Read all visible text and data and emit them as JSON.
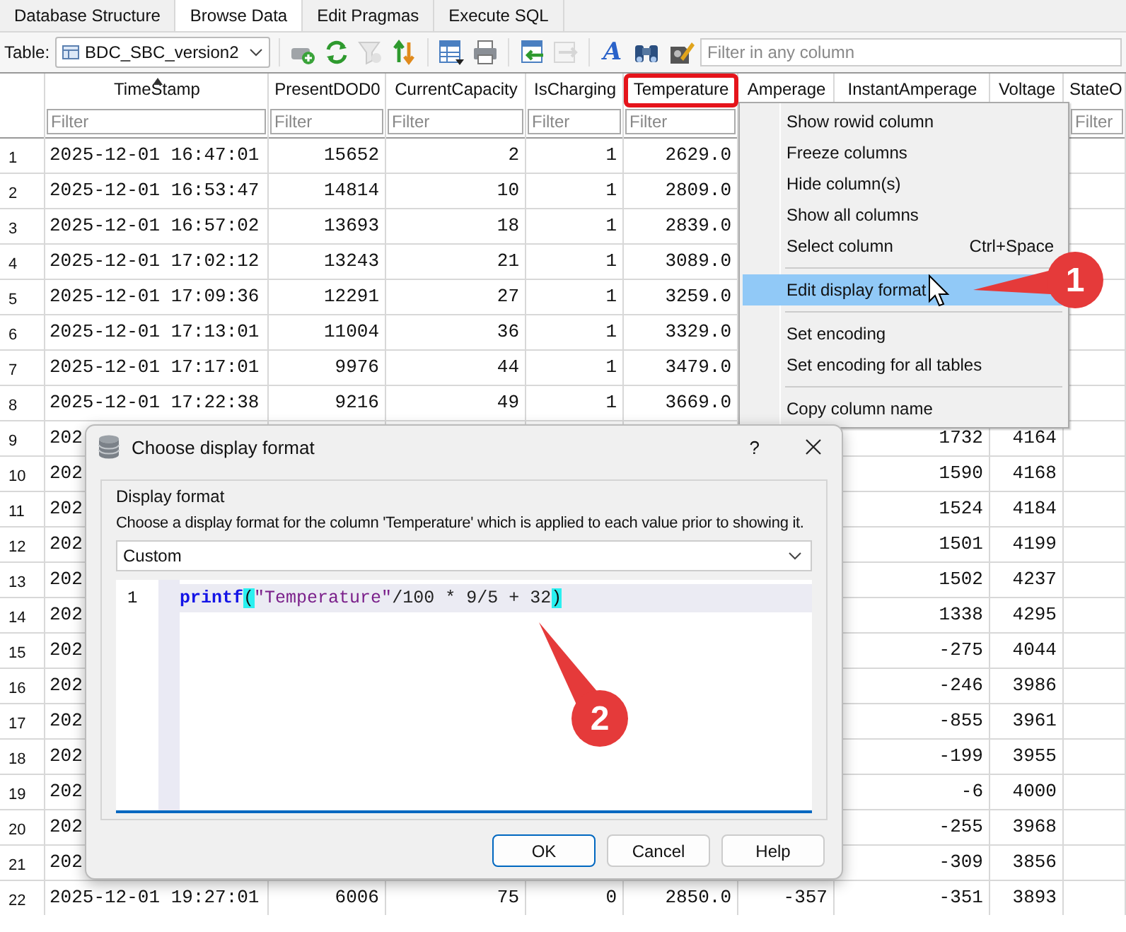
{
  "tabs": [
    {
      "label": "Database Structure",
      "selected": false
    },
    {
      "label": "Browse Data",
      "selected": true
    },
    {
      "label": "Edit Pragmas",
      "selected": false
    },
    {
      "label": "Execute SQL",
      "selected": false
    }
  ],
  "toolbar": {
    "table_label": "Table:",
    "table_name": "BDC_SBC_version2",
    "filter_placeholder": "Filter in any column",
    "tool_groups": [
      [
        {
          "kind": "add-row",
          "disabled": false
        },
        {
          "kind": "refresh",
          "disabled": false
        },
        {
          "kind": "funnel",
          "disabled": true
        },
        {
          "kind": "sort",
          "disabled": false
        }
      ],
      [
        {
          "kind": "table",
          "disabled": false
        },
        {
          "kind": "printer",
          "disabled": false
        }
      ],
      [
        {
          "kind": "import",
          "disabled": false
        },
        {
          "kind": "export",
          "disabled": true
        }
      ],
      [
        {
          "kind": "font",
          "label": "A",
          "disabled": false
        },
        {
          "kind": "binoculars",
          "disabled": false
        },
        {
          "kind": "pencil",
          "disabled": false
        }
      ]
    ]
  },
  "table": {
    "columns": [
      {
        "label": "TimeStamp",
        "sorted": true,
        "highlighted": false,
        "placeholder": "Filter"
      },
      {
        "label": "PresentDOD0",
        "sorted": false,
        "highlighted": false,
        "placeholder": "Filter"
      },
      {
        "label": "CurrentCapacity",
        "sorted": false,
        "highlighted": false,
        "placeholder": "Filter"
      },
      {
        "label": "IsCharging",
        "sorted": false,
        "highlighted": false,
        "placeholder": "Filter"
      },
      {
        "label": "Temperature",
        "sorted": false,
        "highlighted": true,
        "placeholder": "Filter"
      },
      {
        "label": "Amperage",
        "sorted": false,
        "highlighted": false
      },
      {
        "label": "InstantAmperage",
        "sorted": false,
        "highlighted": false
      },
      {
        "label": "Voltage",
        "sorted": false,
        "highlighted": false
      },
      {
        "label": "StateO",
        "sorted": false,
        "highlighted": false,
        "placeholder": "Filter"
      }
    ],
    "rows": [
      {
        "number": "1",
        "timestamp": "2025-12-01 16:47:01",
        "present_dod0": "15652",
        "current_capacity": "2",
        "is_charging": "1",
        "temperature": "2629.0"
      },
      {
        "number": "2",
        "timestamp": "2025-12-01 16:53:47",
        "present_dod0": "14814",
        "current_capacity": "10",
        "is_charging": "1",
        "temperature": "2809.0"
      },
      {
        "number": "3",
        "timestamp": "2025-12-01 16:57:02",
        "present_dod0": "13693",
        "current_capacity": "18",
        "is_charging": "1",
        "temperature": "2839.0"
      },
      {
        "number": "4",
        "timestamp": "2025-12-01 17:02:12",
        "present_dod0": "13243",
        "current_capacity": "21",
        "is_charging": "1",
        "temperature": "3089.0"
      },
      {
        "number": "5",
        "timestamp": "2025-12-01 17:09:36",
        "present_dod0": "12291",
        "current_capacity": "27",
        "is_charging": "1",
        "temperature": "3259.0"
      },
      {
        "number": "6",
        "timestamp": "2025-12-01 17:13:01",
        "present_dod0": "11004",
        "current_capacity": "36",
        "is_charging": "1",
        "temperature": "3329.0"
      },
      {
        "number": "7",
        "timestamp": "2025-12-01 17:17:01",
        "present_dod0": "9976",
        "current_capacity": "44",
        "is_charging": "1",
        "temperature": "3479.0"
      },
      {
        "number": "8",
        "timestamp": "2025-12-01 17:22:38",
        "present_dod0": "9216",
        "current_capacity": "49",
        "is_charging": "1",
        "temperature": "3669.0"
      },
      {
        "number": "9",
        "timestamp": "202",
        "instant_amperage": "1732",
        "voltage": "4164"
      },
      {
        "number": "10",
        "timestamp": "202",
        "instant_amperage": "1590",
        "voltage": "4168"
      },
      {
        "number": "11",
        "timestamp": "202",
        "instant_amperage": "1524",
        "voltage": "4184"
      },
      {
        "number": "12",
        "timestamp": "202",
        "instant_amperage": "1501",
        "voltage": "4199"
      },
      {
        "number": "13",
        "timestamp": "202",
        "instant_amperage": "1502",
        "voltage": "4237"
      },
      {
        "number": "14",
        "timestamp": "202",
        "instant_amperage": "1338",
        "voltage": "4295"
      },
      {
        "number": "15",
        "timestamp": "202",
        "instant_amperage": "-275",
        "voltage": "4044"
      },
      {
        "number": "16",
        "timestamp": "202",
        "instant_amperage": "-246",
        "voltage": "3986"
      },
      {
        "number": "17",
        "timestamp": "202",
        "instant_amperage": "-855",
        "voltage": "3961"
      },
      {
        "number": "18",
        "timestamp": "202",
        "instant_amperage": "-199",
        "voltage": "3955"
      },
      {
        "number": "19",
        "timestamp": "202",
        "instant_amperage": "-6",
        "voltage": "4000"
      },
      {
        "number": "20",
        "timestamp": "202",
        "instant_amperage": "-255",
        "voltage": "3968"
      },
      {
        "number": "21",
        "timestamp": "202",
        "instant_amperage": "-309",
        "voltage": "3856"
      },
      {
        "number": "22",
        "timestamp": "2025-12-01 19:27:01",
        "present_dod0": "6006",
        "current_capacity": "75",
        "is_charging": "0",
        "temperature": "2850.0",
        "amperage": "-357",
        "instant_amperage": "-351",
        "voltage": "3893"
      }
    ]
  },
  "context_menu": {
    "groups": [
      [
        {
          "label": "Show rowid column",
          "selected": false
        },
        {
          "label": "Freeze columns",
          "selected": false
        },
        {
          "label": "Hide column(s)",
          "selected": false
        },
        {
          "label": "Show all columns",
          "selected": false
        },
        {
          "label": "Select column",
          "shortcut": "Ctrl+Space",
          "selected": false
        }
      ],
      [
        {
          "label": "Edit display format",
          "selected": true
        }
      ],
      [
        {
          "label": "Set encoding",
          "selected": false
        },
        {
          "label": "Set encoding for all tables",
          "selected": false
        }
      ],
      [
        {
          "label": "Copy column name",
          "selected": false
        }
      ]
    ]
  },
  "dialog": {
    "title": "Choose display format",
    "help_button": "?",
    "group_title": "Display format",
    "description": "Choose a display format for the column 'Temperature' which is applied to each value prior to showing it.",
    "format": "Custom",
    "editor": {
      "lines": [
        {
          "number": "1",
          "current": true,
          "tokens": [
            {
              "kind": "function",
              "text": "printf"
            },
            {
              "kind": "bracket_match",
              "text": "("
            },
            {
              "kind": "string",
              "text": "\"Temperature\""
            },
            {
              "kind": "plain",
              "text": "/100 * 9/5 + 32"
            },
            {
              "kind": "bracket_match",
              "text": ")"
            }
          ]
        }
      ]
    },
    "buttons": [
      {
        "label": "OK",
        "default": true
      },
      {
        "label": "Cancel",
        "default": false
      },
      {
        "label": "Help",
        "default": false
      }
    ]
  },
  "callouts": [
    {
      "label": "1"
    },
    {
      "label": "2"
    }
  ]
}
